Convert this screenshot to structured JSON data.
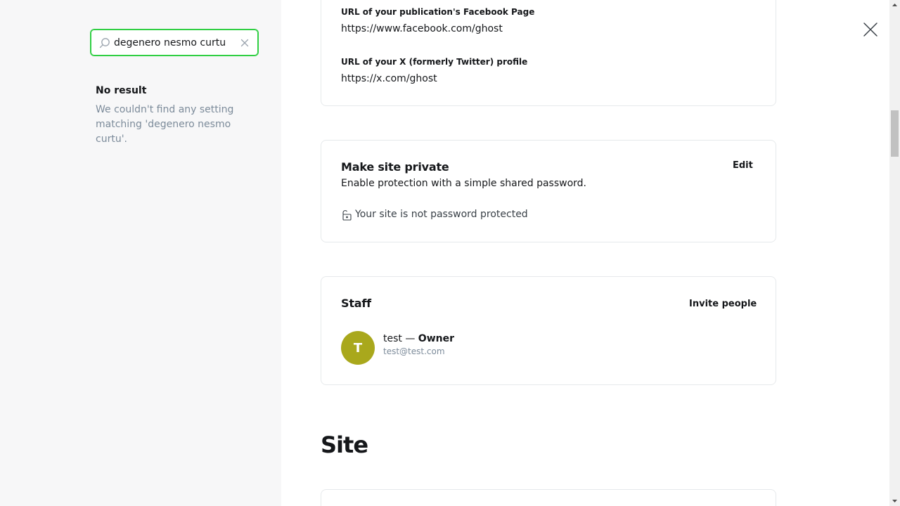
{
  "sidebar": {
    "search": {
      "value": "degenero nesmo curtu",
      "placeholder": "Search settings"
    },
    "no_result_title": "No result",
    "no_result_text": "We couldn't find any setting matching 'degenero nesmo curtu'."
  },
  "social": {
    "facebook_label": "URL of your publication's Facebook Page",
    "facebook_value": "https://www.facebook.com/ghost",
    "x_label": "URL of your X (formerly Twitter) profile",
    "x_value": "https://x.com/ghost"
  },
  "private": {
    "title": "Make site private",
    "description": "Enable protection with a simple shared password.",
    "edit_label": "Edit",
    "status_text": "Your site is not password protected"
  },
  "staff": {
    "title": "Staff",
    "invite_label": "Invite people",
    "members": [
      {
        "initial": "T",
        "name": "test",
        "separator": " — ",
        "role": "Owner",
        "email": "test@test.com",
        "avatar_color": "#a9a81c"
      }
    ]
  },
  "site_section": {
    "title": "Site"
  },
  "colors": {
    "accent_focus": "#30cf43",
    "muted_text": "#7c8b9a",
    "sidebar_bg": "#f7f7f8"
  },
  "icons": {
    "search": "search-icon",
    "clear": "close-icon",
    "close": "close-icon",
    "lock": "lock-open-icon"
  }
}
